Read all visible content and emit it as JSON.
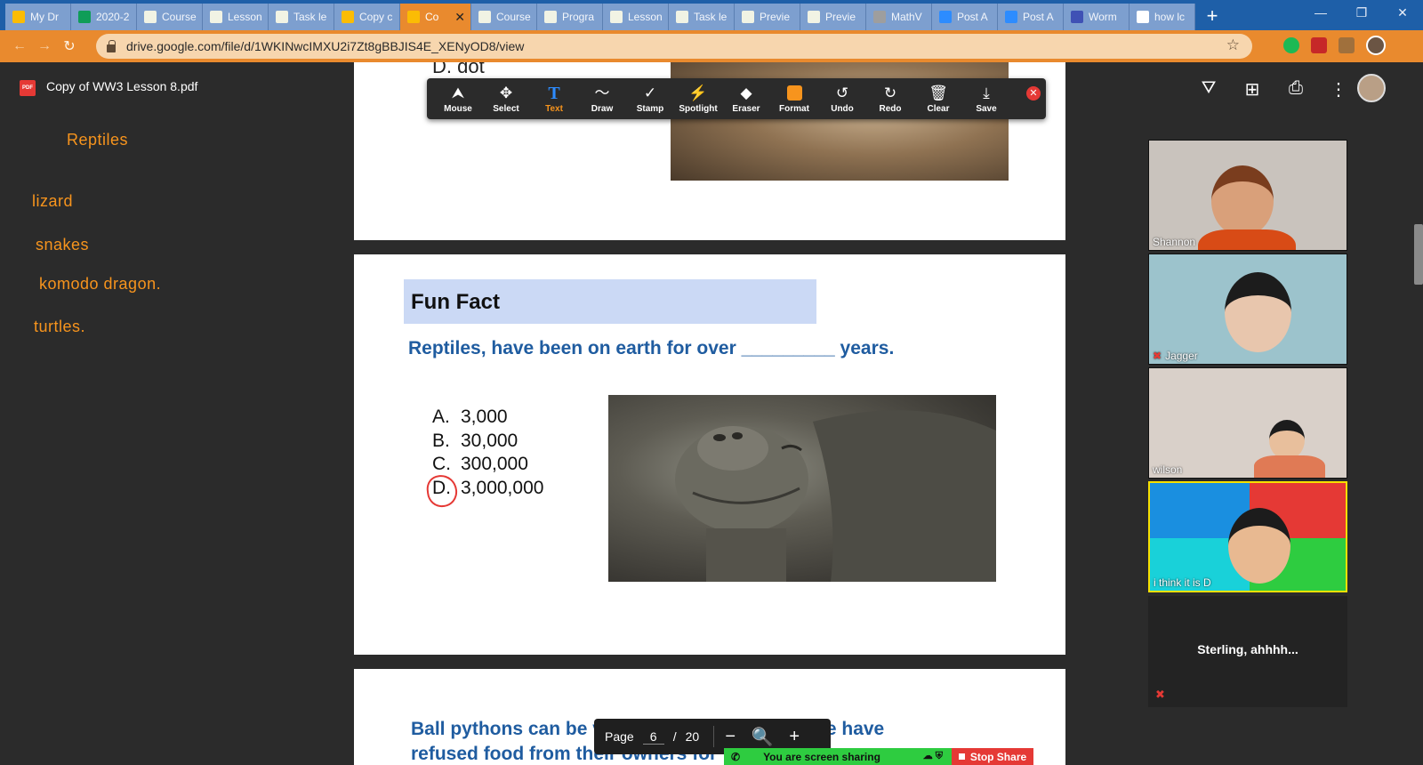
{
  "browser": {
    "tabs": [
      {
        "title": "My Dr",
        "color": "#fbbc04",
        "active": false
      },
      {
        "title": "2020-2",
        "color": "#0f9d58",
        "active": false
      },
      {
        "title": "Course",
        "color": "#f1f3e4",
        "active": false
      },
      {
        "title": "Lesson",
        "color": "#f1f3e4",
        "active": false
      },
      {
        "title": "Task le",
        "color": "#f1f3e4",
        "active": false
      },
      {
        "title": "Copy c",
        "color": "#fbbc04",
        "active": false
      },
      {
        "title": "Co",
        "color": "#fbbc04",
        "active": true
      },
      {
        "title": "Course",
        "color": "#f1f3e4",
        "active": false
      },
      {
        "title": "Progra",
        "color": "#f1f3e4",
        "active": false
      },
      {
        "title": "Lesson",
        "color": "#f1f3e4",
        "active": false
      },
      {
        "title": "Task le",
        "color": "#f1f3e4",
        "active": false
      },
      {
        "title": "Previe",
        "color": "#f1f3e4",
        "active": false
      },
      {
        "title": "Previe",
        "color": "#f1f3e4",
        "active": false
      },
      {
        "title": "MathV",
        "color": "#9e9e9e",
        "active": false
      },
      {
        "title": "Post A",
        "color": "#2d8cff",
        "active": false
      },
      {
        "title": "Post A",
        "color": "#2d8cff",
        "active": false
      },
      {
        "title": "Worm",
        "color": "#3f51b5",
        "active": false
      },
      {
        "title": "how lc",
        "color": "#ffffff",
        "active": false
      }
    ],
    "new_tab_label": "+",
    "url": "drive.google.com/file/d/1WKINwcIMXU2i7Zt8gBBJIS4E_XENyOD8/view"
  },
  "drive": {
    "file_title": "Copy of WW3 Lesson 8.pdf",
    "pdf_badge": "PDF"
  },
  "notes": {
    "heading": "Reptiles",
    "items": [
      "lizard",
      "snakes",
      "komodo dragon.",
      "turtles."
    ]
  },
  "pdf": {
    "prev_answer": "D. dot",
    "funfact_title": "Fun Fact",
    "question": "Reptiles, have been on earth for over _________ years.",
    "options": [
      {
        "letter": "A.",
        "value": "3,000"
      },
      {
        "letter": "B.",
        "value": "30,000"
      },
      {
        "letter": "C.",
        "value": "300,000"
      },
      {
        "letter": "D.",
        "value": "3,000,000"
      }
    ],
    "next_line_1": "Ball pythons can be very picky eaters and some have",
    "next_line_2": "refused food from their owners for"
  },
  "annotation_toolbar": {
    "tools": [
      {
        "label": "Mouse",
        "icon": "⮝",
        "active": false
      },
      {
        "label": "Select",
        "icon": "✥",
        "active": false
      },
      {
        "label": "Text",
        "icon": "T",
        "active": true
      },
      {
        "label": "Draw",
        "icon": "〜",
        "active": false
      },
      {
        "label": "Stamp",
        "icon": "✓",
        "active": false
      },
      {
        "label": "Spotlight",
        "icon": "⚡",
        "active": false
      },
      {
        "label": "Eraser",
        "icon": "◆",
        "active": false
      },
      {
        "label": "Format",
        "icon": "",
        "active": false
      },
      {
        "label": "Undo",
        "icon": "↺",
        "active": false
      },
      {
        "label": "Redo",
        "icon": "↻",
        "active": false
      },
      {
        "label": "Clear",
        "icon": "🗑",
        "active": false
      },
      {
        "label": "Save",
        "icon": "⤓",
        "active": false
      }
    ],
    "format_color": "#f7941d"
  },
  "participants": [
    {
      "name": "Shannon",
      "muted": false,
      "bg": "#c9c3bd"
    },
    {
      "name": "Jagger",
      "muted": true,
      "bg": "#9cc3cc"
    },
    {
      "name": "wilson",
      "muted": false,
      "bg": "#d9d0c9"
    },
    {
      "name": "i think it is D",
      "muted": false,
      "bg": "#1a8fe0"
    }
  ],
  "sterling_tile": {
    "name": "Sterling,  ahhhh..."
  },
  "page_controls": {
    "label": "Page",
    "current": "6",
    "separator": "/",
    "total": "20"
  },
  "screen_share": {
    "status": "You are screen sharing",
    "stop_label": "Stop Share"
  }
}
